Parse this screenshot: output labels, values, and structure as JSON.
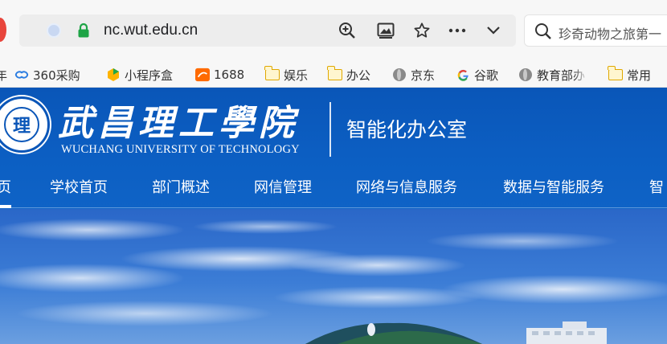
{
  "browser": {
    "url": "nc.wut.edu.cn",
    "search_text": "珍奇动物之旅第一",
    "icons": [
      "site-info-icon",
      "lock-icon",
      "zoom-icon",
      "reader-icon",
      "star-icon",
      "more-icon",
      "chevron-down-icon",
      "search-icon"
    ]
  },
  "bookmarks": [
    {
      "label": "360采购",
      "icon": "360-icon"
    },
    {
      "label": "小程序盒",
      "icon": "mini-program-icon"
    },
    {
      "label": "1688",
      "icon": "alibaba-1688-icon"
    },
    {
      "label": "娱乐",
      "icon": "folder-icon"
    },
    {
      "label": "办公",
      "icon": "folder-icon"
    },
    {
      "label": "京东",
      "icon": "globe-icon"
    },
    {
      "label": "谷歌",
      "icon": "google-icon"
    },
    {
      "label": "教育部办",
      "icon": "globe-icon"
    },
    {
      "label": "常用",
      "icon": "folder-icon"
    }
  ],
  "bookmark_left_fragment": "年",
  "site": {
    "seal_glyph": "理",
    "name_cn": "武昌理工學院",
    "name_en": "WUCHANG UNIVERSITY OF TECHNOLOGY",
    "office_title": "智能化办公室",
    "nav": [
      "页",
      "学校首页",
      "部门概述",
      "网信管理",
      "网络与信息服务",
      "数据与智能服务",
      "智"
    ]
  },
  "colors": {
    "header_blue": "#0a56b8",
    "sky_blue": "#2f6fd0",
    "white": "#ffffff"
  }
}
